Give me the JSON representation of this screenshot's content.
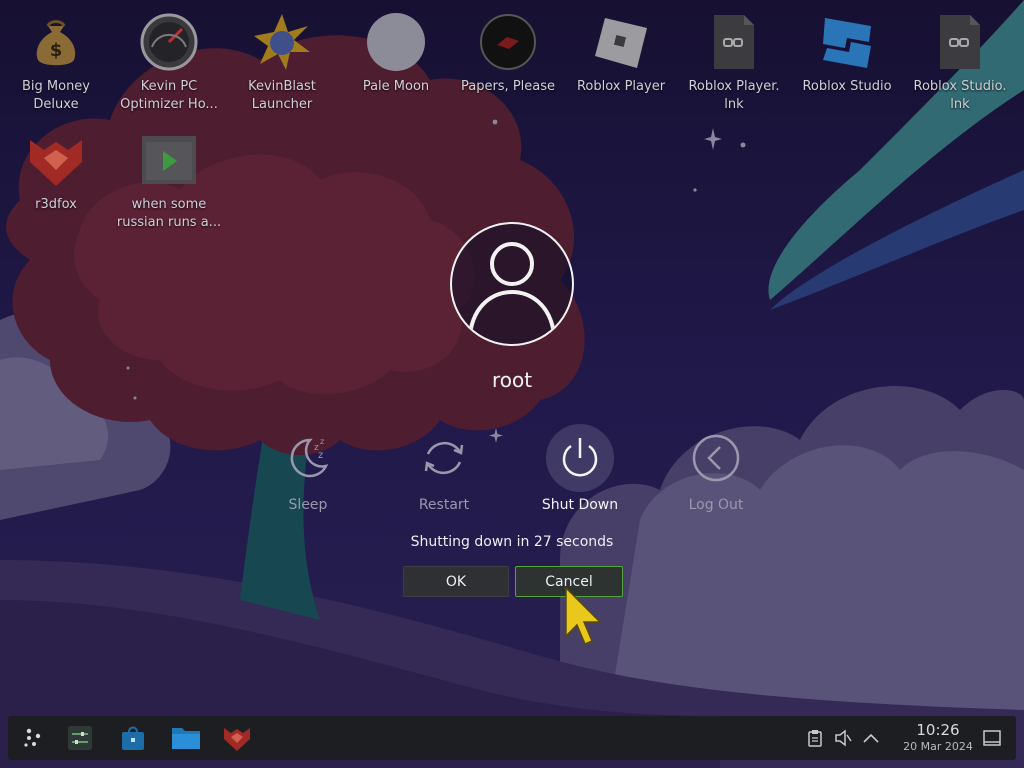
{
  "desktop": {
    "icons": [
      {
        "label": "Big Money Deluxe",
        "icon": "money-bag-icon"
      },
      {
        "label": "Kevin PC Optimizer Ho...",
        "icon": "gauge-icon"
      },
      {
        "label": "KevinBlast Launcher",
        "icon": "starburst-icon"
      },
      {
        "label": "Pale Moon",
        "icon": "moon-icon"
      },
      {
        "label": "Papers, Please",
        "icon": "seal-icon"
      },
      {
        "label": "Roblox Player",
        "icon": "roblox-icon"
      },
      {
        "label": "Roblox Player. lnk",
        "icon": "shortcut-file-icon"
      },
      {
        "label": "Roblox Studio",
        "icon": "roblox-studio-icon"
      },
      {
        "label": "Roblox Studio. lnk",
        "icon": "shortcut-file-icon"
      },
      {
        "label": "r3dfox",
        "icon": "r3dfox-icon"
      },
      {
        "label": "when some russian runs a...",
        "icon": "video-file-icon"
      }
    ]
  },
  "logout_dialog": {
    "username": "root",
    "actions": [
      {
        "label": "Sleep",
        "icon": "sleep-icon",
        "selected": false
      },
      {
        "label": "Restart",
        "icon": "restart-icon",
        "selected": false
      },
      {
        "label": "Shut Down",
        "icon": "power-icon",
        "selected": true
      },
      {
        "label": "Log Out",
        "icon": "logout-icon",
        "selected": false
      }
    ],
    "countdown_text": "Shutting down in 27 seconds",
    "ok_label": "OK",
    "cancel_label": "Cancel"
  },
  "taskbar": {
    "launcher_icon": "app-launcher-icon",
    "pinned": [
      {
        "name": "system-settings",
        "icon": "settings-sliders-icon"
      },
      {
        "name": "discover",
        "icon": "store-bag-icon"
      },
      {
        "name": "file-manager",
        "icon": "folder-icon"
      },
      {
        "name": "r3dfox",
        "icon": "r3dfox-icon"
      }
    ],
    "tray": [
      "clipboard-icon",
      "volume-muted-icon",
      "chevron-up-icon"
    ],
    "clock_time": "10:26",
    "clock_date": "20 Mar 2024",
    "show_desktop_icon": "show-desktop-icon"
  },
  "colors": {
    "cancel_border": "#55a536",
    "taskbar_bg": "#1d1e22",
    "sky": "#2a1f5c"
  }
}
